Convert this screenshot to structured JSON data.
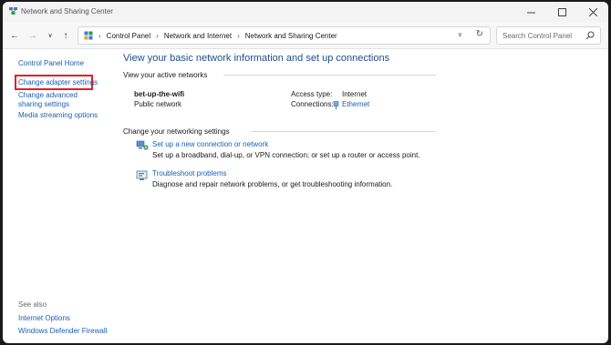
{
  "window": {
    "title": "Network and Sharing Center",
    "icon": "network-sharing-icon"
  },
  "nav": {
    "breadcrumbs": [
      "Control Panel",
      "Network and Internet",
      "Network and Sharing Center"
    ],
    "search_placeholder": "Search Control Panel"
  },
  "sidebar": {
    "home": "Control Panel Home",
    "items": [
      "Change adapter settings",
      "Change advanced sharing settings",
      "Media streaming options"
    ],
    "see_also_label": "See also",
    "see_also": [
      "Internet Options",
      "Windows Defender Firewall"
    ],
    "highlight_color": "#e0202a"
  },
  "main": {
    "title": "View your basic network information and set up connections",
    "active_networks_label": "View your active networks",
    "network": {
      "name": "bet-up-the-wifi",
      "type": "Public network",
      "access_type_label": "Access type:",
      "access_type_value": "Internet",
      "connections_label": "Connections:",
      "connections_value": "Ethernet"
    },
    "change_settings_label": "Change your networking settings",
    "tasks": [
      {
        "link": "Set up a new connection or network",
        "description": "Set up a broadband, dial-up, or VPN connection; or set up a router or access point.",
        "icon": "new-connection-icon"
      },
      {
        "link": "Troubleshoot problems",
        "description": "Diagnose and repair network problems, or get troubleshooting information.",
        "icon": "troubleshoot-icon"
      }
    ]
  },
  "colors": {
    "link": "#1a5fb4",
    "title": "#1e4e8c"
  }
}
